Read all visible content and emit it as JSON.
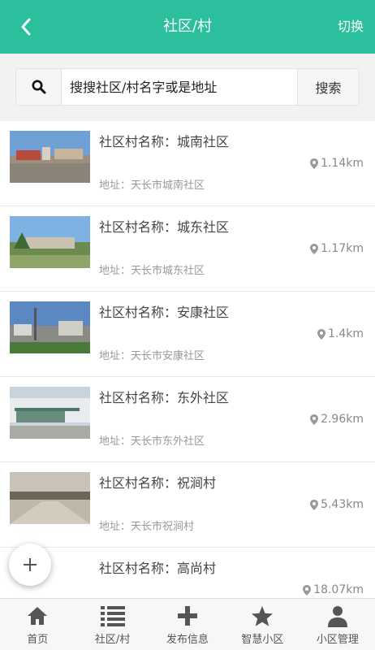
{
  "header": {
    "title": "社区/村",
    "switch_label": "切换"
  },
  "search": {
    "placeholder": "搜搜社区/村名字或是地址",
    "button_label": "搜索"
  },
  "communities": [
    {
      "name": "社区村名称：城南社区",
      "address": "地址：天长市城南社区",
      "distance": "1.14km"
    },
    {
      "name": "社区村名称：城东社区",
      "address": "地址：天长市城东社区",
      "distance": "1.17km"
    },
    {
      "name": "社区村名称：安康社区",
      "address": "地址：天长市安康社区",
      "distance": "1.4km"
    },
    {
      "name": "社区村名称：东外社区",
      "address": "地址：天长市东外社区",
      "distance": "2.96km"
    },
    {
      "name": "社区村名称：祝涧村",
      "address": "地址：天长市祝涧村",
      "distance": "5.43km"
    },
    {
      "name": "社区村名称：高尚村",
      "address": "",
      "distance": "18.07km"
    }
  ],
  "tabs": [
    {
      "label": "首页",
      "icon": "home-icon"
    },
    {
      "label": "社区/村",
      "icon": "list-icon"
    },
    {
      "label": "发布信息",
      "icon": "plus-icon"
    },
    {
      "label": "智慧小区",
      "icon": "star-icon"
    },
    {
      "label": "小区管理",
      "icon": "user-icon"
    }
  ],
  "colors": {
    "accent": "#2bbf9d",
    "tab_icon": "#555555"
  }
}
